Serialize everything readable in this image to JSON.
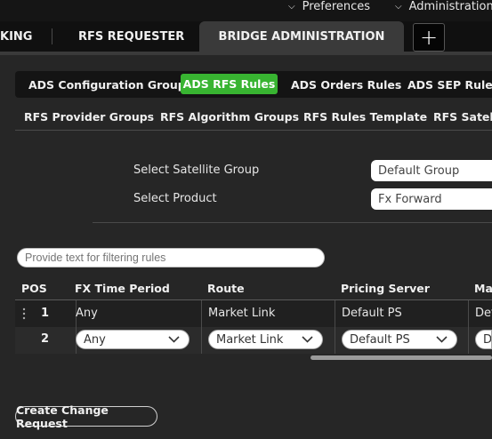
{
  "top_menu": {
    "preferences": "Preferences",
    "administration": "Administration"
  },
  "tabs": {
    "partial_left": "KING",
    "rfs_requester": "RFS REQUESTER",
    "bridge_administration": "BRIDGE ADMINISTRATION",
    "add_symbol": "+"
  },
  "sub_tabs_1": [
    "ADS Configuration Groups",
    "ADS RFS Rules",
    "ADS Orders Rules",
    "ADS SEP Rules"
  ],
  "sub_tabs_2": [
    "RFS Provider Groups",
    "RFS Algorithm Groups",
    "RFS Rules Template",
    "RFS Satellit"
  ],
  "form": {
    "satellite_label": "Select Satellite Group",
    "satellite_value": "Default Group",
    "product_label": "Select Product",
    "product_value": "Fx Forward"
  },
  "filter": {
    "placeholder": "Provide text for filtering rules"
  },
  "grid": {
    "headers": [
      "POS",
      "FX Time Period",
      "Route",
      "Pricing Server",
      "Ma"
    ],
    "rows": [
      {
        "pos": "1",
        "time_period": "Any",
        "route": "Market Link",
        "pricing_server": "Default PS",
        "next": "Def"
      },
      {
        "pos": "2",
        "time_period": "Any",
        "route": "Market Link",
        "pricing_server": "Default PS",
        "next": "De"
      }
    ]
  },
  "actions": {
    "create_change_request": "Create Change Request"
  },
  "colors": {
    "accent_green": "#38b431",
    "background": "#262626",
    "tab_active": "#3a3a3a"
  }
}
